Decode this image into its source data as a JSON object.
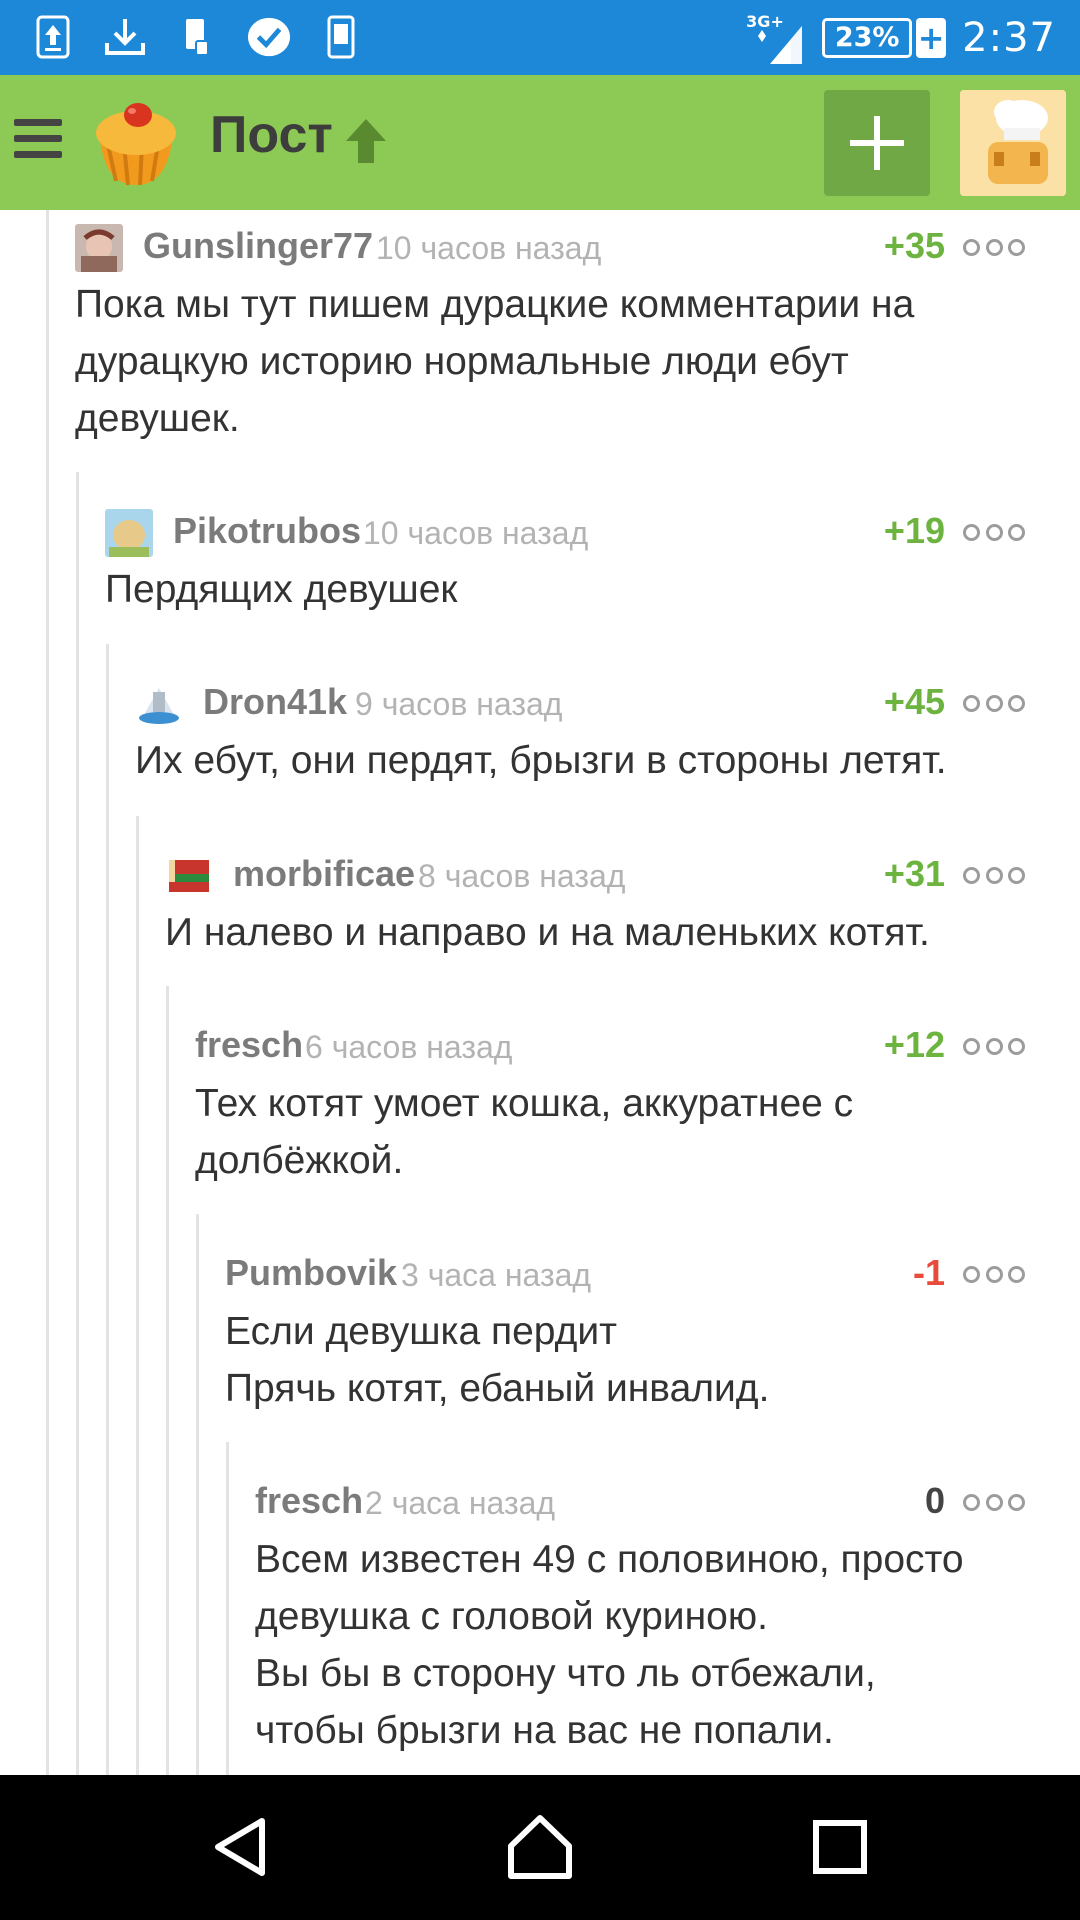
{
  "status_bar": {
    "icons": [
      "upload-icon",
      "download-icon",
      "sim-icon",
      "check-badge-icon",
      "phone-icon"
    ],
    "network": "3G+",
    "battery": "23%",
    "time": "2:37"
  },
  "app_bar": {
    "title": "Пост",
    "menu_icon": "hamburger-icon",
    "logo_icon": "cupcake-logo",
    "up_icon": "arrow-up-icon",
    "add_icon": "plus-icon",
    "profile_icon": "user-avatar"
  },
  "colors": {
    "status_bar": "#1e88d8",
    "app_bar": "#8dca55",
    "positive": "#6db33f",
    "negative": "#e84b3a"
  },
  "comments": [
    {
      "user": "Gunslinger77",
      "time": "10 часов назад",
      "score": "+35",
      "lines": [
        "Пока мы тут пишем дурацкие комментарии на",
        "дурацкую историю нормальные люди ебут",
        "девушек."
      ]
    },
    {
      "user": "Pikotrubos",
      "time": "10 часов назад",
      "score": "+19",
      "lines": [
        "Пердящих девушек"
      ]
    },
    {
      "user": "Dron41k",
      "time": "9 часов назад",
      "score": "+45",
      "lines": [
        "Их ебут, они пердят, брызги в стороны летят."
      ]
    },
    {
      "user": "morbificae",
      "time": "8 часов назад",
      "score": "+31",
      "lines": [
        "И налево и направо и на маленьких котят."
      ]
    },
    {
      "user": "fresch",
      "time": "6 часов назад",
      "score": "+12",
      "lines": [
        "Тех котят умоет кошка, аккуратнее с",
        "долбёжкой."
      ]
    },
    {
      "user": "Pumbovik",
      "time": "3 часа назад",
      "score": "-1",
      "lines": [
        "Если девушка пердит",
        "Прячь котят, ебаный инвалид."
      ]
    },
    {
      "user": "fresch",
      "time": "2 часа назад",
      "score": "0",
      "lines": [
        "Всем известен 49 с половиною, просто",
        "девушка с головой куриною.",
        "Вы бы в сторону что ль отбежали,",
        "чтобы брызги на вас не попали."
      ]
    }
  ],
  "nav_bar": {
    "back_icon": "back-triangle-icon",
    "home_icon": "home-icon",
    "recents_icon": "recents-square-icon"
  }
}
